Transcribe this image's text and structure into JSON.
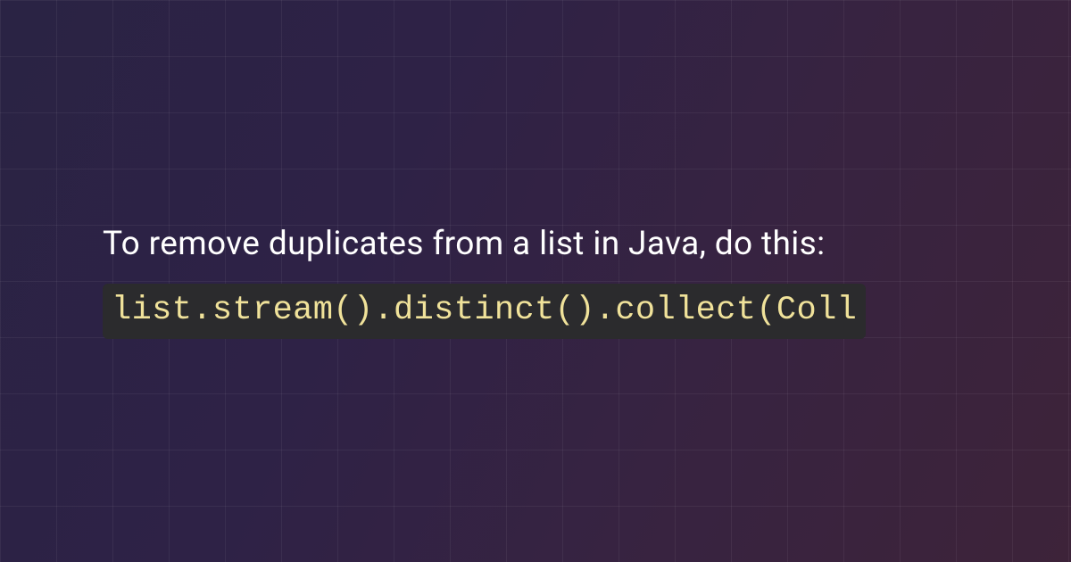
{
  "snippet": {
    "description": "To remove duplicates from a list in Java, do this:",
    "code": "list.stream().distinct().collect(Coll"
  }
}
